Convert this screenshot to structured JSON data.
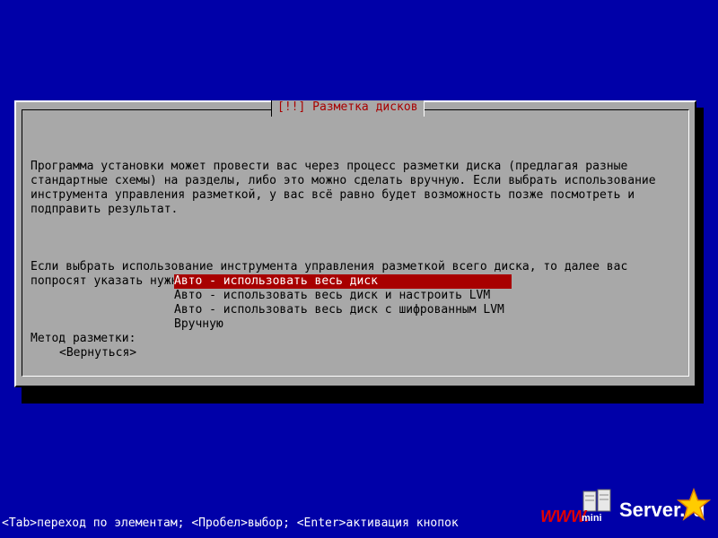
{
  "dialog": {
    "title": "[!!] Разметка дисков",
    "paragraphs": [
      "Программа установки может провести вас через процесс разметки диска (предлагая разные\nстандартные схемы) на разделы, либо это можно сделать вручную. Если выбрать использование\nинструмента управления разметкой, у вас всё равно будет возможность позже посмотреть и\nподправить результат.",
      "Если выбрать использование инструмента управления разметкой всего диска, то далее вас\nпопросят указать нужный диск."
    ],
    "method_label": "Метод разметки:",
    "options": [
      "Авто - использовать весь диск",
      "Авто - использовать весь диск и настроить LVM",
      "Авто - использовать весь диск с шифрованным LVM",
      "Вручную"
    ],
    "selected_index": 0,
    "back_label": "<Вернуться>"
  },
  "status_bar": {
    "text": "<Tab>переход по элементам; <Пробел>выбор; <Enter>активация кнопок"
  },
  "logo": {
    "www": "WWW.",
    "mini": "mini",
    "server": "Server.ru",
    "server_icon": "server-rack-icon",
    "star_icon": "star-icon"
  },
  "colors": {
    "background": "#0000a8",
    "dialog": "#a8a8a8",
    "title": "#a80000",
    "selection": "#a80000",
    "status_text": "#ffffff"
  }
}
